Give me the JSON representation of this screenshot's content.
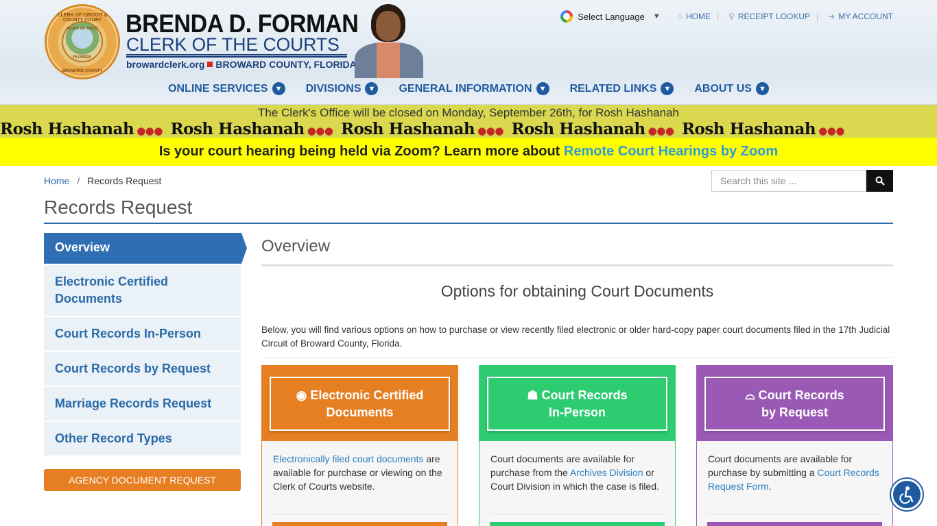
{
  "header": {
    "seal_top_text": "CLERK OF CIRCUIT & COUNTY COURT",
    "seal_motto": "IN GOD WE TRUST",
    "seal_state": "FLORIDA",
    "seal_bottom_text": "BROWARD COUNTY",
    "name": "BRENDA D. FORMAN",
    "subtitle": "CLERK OF THE COURTS",
    "url": "browardclerk.org",
    "county": "BROWARD COUNTY, FLORIDA"
  },
  "topnav": {
    "translate": "Select Language",
    "translate_caret": "▼",
    "home": "HOME",
    "receipt": "RECEIPT LOOKUP",
    "account": "MY ACCOUNT"
  },
  "mainnav": [
    {
      "label": "ONLINE SERVICES"
    },
    {
      "label": "DIVISIONS"
    },
    {
      "label": "GENERAL INFORMATION"
    },
    {
      "label": "RELATED LINKS"
    },
    {
      "label": "ABOUT US"
    }
  ],
  "notices": {
    "closure": "The Clerk's Office will be closed on Monday, September 26th, for Rosh Hashanah",
    "marquee": "Rosh Hashanah",
    "zoom_text": "Is your court hearing being held via Zoom? Learn more about",
    "zoom_link": "Remote Court Hearings by Zoom"
  },
  "breadcrumb": {
    "home": "Home",
    "separator": "/",
    "current": "Records Request"
  },
  "search": {
    "placeholder": "Search this site ..."
  },
  "page_title": "Records Request",
  "sidebar": {
    "items": [
      {
        "label": "Overview"
      },
      {
        "label": "Electronic Certified Documents"
      },
      {
        "label": "Court Records In-Person"
      },
      {
        "label": "Court Records by Request"
      },
      {
        "label": "Marriage Records Request"
      },
      {
        "label": "Other Record Types"
      }
    ],
    "agency_button": "AGENCY DOCUMENT REQUEST"
  },
  "content": {
    "section_title": "Overview",
    "options_title": "Options for obtaining Court Documents",
    "description": "Below, you will find various options on how to purchase or view recently filed electronic or older hard-copy paper court documents filed in the 17th Judicial Circuit of Broward County, Florida."
  },
  "cards": [
    {
      "line1": "Electronic Certified",
      "line2": "Documents",
      "body_link": "Electronically filed court documents",
      "body_text": " are available for purchase or viewing on the Clerk of Courts website."
    },
    {
      "line1": "Court Records",
      "line2": "In-Person",
      "body_pre": "Court documents are available for purchase from the ",
      "body_link": "Archives Division",
      "body_post": " or Court Division in which the case is filed."
    },
    {
      "line1": "Court Records",
      "line2": "by Request",
      "body_pre": "Court documents are available for purchase by submitting a ",
      "body_link": "Court Records Request Form",
      "body_post": "."
    }
  ],
  "colors": {
    "brand_blue": "#1e5aa0",
    "notice_olive": "#d9d84e",
    "notice_yellow": "#ffff00",
    "card_orange": "#e67e22",
    "card_green": "#2ecc71",
    "card_purple": "#9b59b6"
  }
}
